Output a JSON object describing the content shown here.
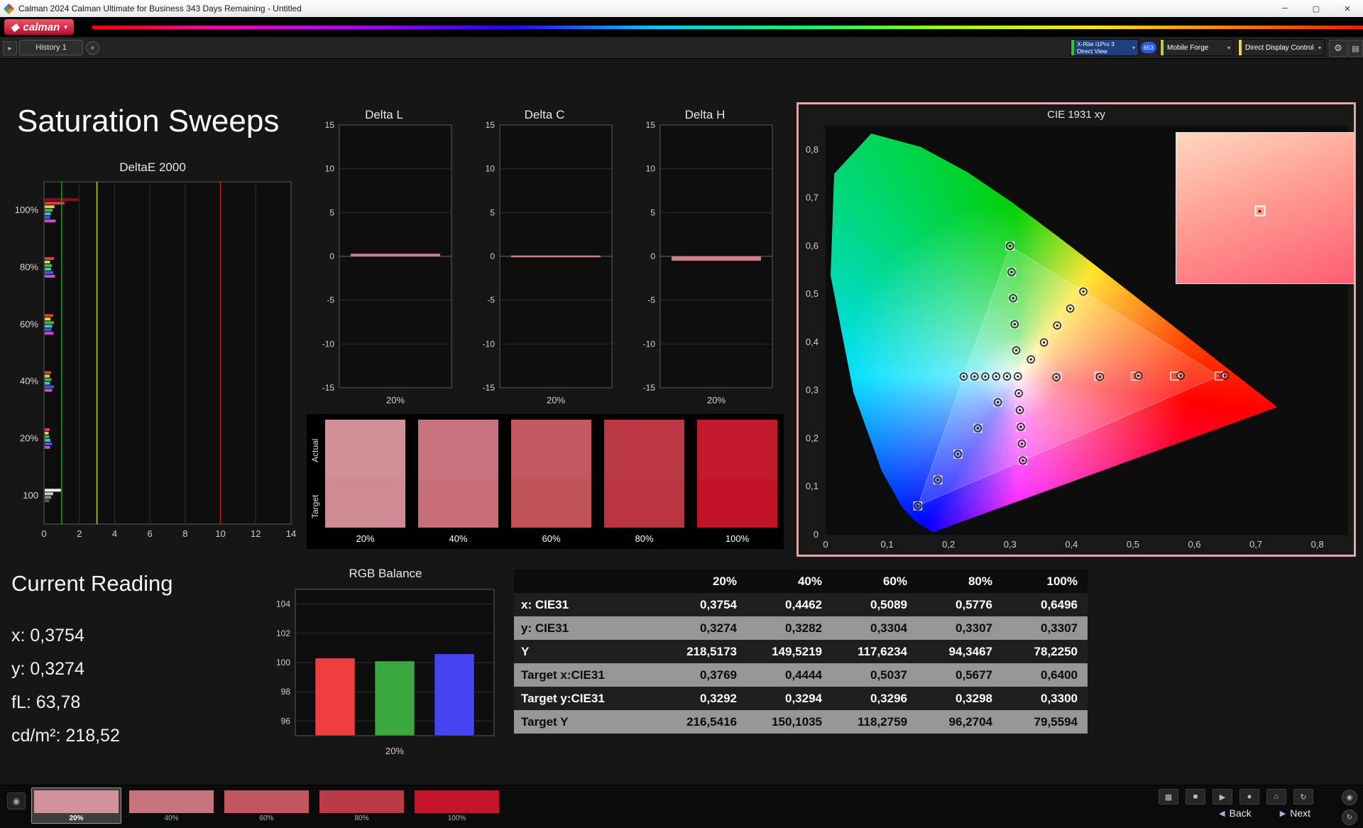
{
  "window": {
    "title": "Calman 2024 Calman Ultimate for Business 343 Days Remaining  - Untitled"
  },
  "icons": {
    "diamond": "◆",
    "dropdown": "▾",
    "toggle": "▸",
    "plus": "+",
    "gear": "⚙",
    "grid": "▤",
    "minimize": "─",
    "maximize": "▢",
    "close": "✕",
    "sensor": "◉",
    "display": "▦",
    "stop": "■",
    "play": "▶",
    "record": "●",
    "home": "⌂",
    "refresh": "↻",
    "back": "◀",
    "next": "▶",
    "round_top": "◉",
    "round_bottom": "↻"
  },
  "brand": {
    "logo_text": "calman"
  },
  "toolbar": {
    "history_tab": "History 1",
    "meter": {
      "line1": "X-Rite i1Pro 3",
      "line2": "Direct View",
      "badge": "653",
      "accent": "#35c235"
    },
    "source": {
      "label": "Mobile Forge",
      "accent": "#b7d435"
    },
    "display_control": {
      "label": "Direct Display Control",
      "accent": "#e8d44d"
    }
  },
  "page": {
    "title": "Saturation Sweeps"
  },
  "current_reading": {
    "heading": "Current Reading",
    "lines": [
      "x: 0,3754",
      "y: 0,3274",
      "fL: 63,78",
      "cd/m²: 218,52"
    ]
  },
  "swatch_strip": {
    "row_labels": [
      "Actual",
      "Target"
    ],
    "columns": [
      {
        "label": "20%",
        "actual": "#d18f98",
        "target": "#cf8b93"
      },
      {
        "label": "40%",
        "actual": "#c8737d",
        "target": "#c66e77"
      },
      {
        "label": "60%",
        "actual": "#c2575f",
        "target": "#c05259"
      },
      {
        "label": "80%",
        "actual": "#bb3944",
        "target": "#ba353f"
      },
      {
        "label": "100%",
        "actual": "#c21a2b",
        "target": "#c11426"
      }
    ]
  },
  "table": {
    "headers": [
      "",
      "20%",
      "40%",
      "60%",
      "80%",
      "100%"
    ],
    "rows": [
      {
        "label": "x: CIE31",
        "values": [
          "0,3754",
          "0,4462",
          "0,5089",
          "0,5776",
          "0,6496"
        ]
      },
      {
        "label": "y: CIE31",
        "values": [
          "0,3274",
          "0,3282",
          "0,3304",
          "0,3307",
          "0,3307"
        ]
      },
      {
        "label": "Y",
        "values": [
          "218,5173",
          "149,5219",
          "117,6234",
          "94,3467",
          "78,2250"
        ]
      },
      {
        "label": "Target x:CIE31",
        "values": [
          "0,3769",
          "0,4444",
          "0,5037",
          "0,5677",
          "0,6400"
        ]
      },
      {
        "label": "Target y:CIE31",
        "values": [
          "0,3292",
          "0,3294",
          "0,3296",
          "0,3298",
          "0,3300"
        ]
      },
      {
        "label": "Target Y",
        "values": [
          "216,5416",
          "150,1035",
          "118,2759",
          "96,2704",
          "79,5594"
        ]
      }
    ]
  },
  "bottom_bar": {
    "swatches": [
      {
        "label": "20%",
        "color": "#d2929b",
        "selected": true
      },
      {
        "label": "40%",
        "color": "#c6747d",
        "selected": false
      },
      {
        "label": "60%",
        "color": "#c0575f",
        "selected": false
      },
      {
        "label": "80%",
        "color": "#ba3a45",
        "selected": false
      },
      {
        "label": "100%",
        "color": "#c3152a",
        "selected": false
      }
    ],
    "back_label": "Back",
    "next_label": "Next"
  },
  "chart_data": [
    {
      "id": "deltaE2000",
      "type": "bar",
      "orientation": "horizontal",
      "title": "DeltaE 2000",
      "xlim": [
        0,
        14
      ],
      "xticks": [
        0,
        2,
        4,
        6,
        8,
        10,
        12,
        14
      ],
      "ref_lines": [
        {
          "value": 1,
          "color": "#19a319"
        },
        {
          "value": 3,
          "color": "#c9c919"
        },
        {
          "value": 10,
          "color": "#c91919"
        }
      ],
      "groups": [
        {
          "label": "100%",
          "bars": [
            {
              "color": "#7c1318",
              "value": 1.92
            },
            {
              "color": "#e23b3b",
              "value": 1.12
            },
            {
              "color": "#d6d64a",
              "value": 0.55
            },
            {
              "color": "#46b34a",
              "value": 0.45
            },
            {
              "color": "#3fc6c6",
              "value": 0.34
            },
            {
              "color": "#4656e2",
              "value": 0.3
            },
            {
              "color": "#cc4ccc",
              "value": 0.62
            }
          ]
        },
        {
          "label": "80%",
          "bars": [
            {
              "color": "#e23b3b",
              "value": 0.52
            },
            {
              "color": "#d6d64a",
              "value": 0.3
            },
            {
              "color": "#46b34a",
              "value": 0.4
            },
            {
              "color": "#3fc6c6",
              "value": 0.36
            },
            {
              "color": "#4656e2",
              "value": 0.48
            },
            {
              "color": "#cc4ccc",
              "value": 0.58
            }
          ]
        },
        {
          "label": "60%",
          "bars": [
            {
              "color": "#e23b3b",
              "value": 0.47
            },
            {
              "color": "#d6d64a",
              "value": 0.33
            },
            {
              "color": "#46b34a",
              "value": 0.52
            },
            {
              "color": "#3fc6c6",
              "value": 0.42
            },
            {
              "color": "#4656e2",
              "value": 0.38
            },
            {
              "color": "#cc4ccc",
              "value": 0.5
            }
          ]
        },
        {
          "label": "40%",
          "bars": [
            {
              "color": "#e23b3b",
              "value": 0.36
            },
            {
              "color": "#d6d64a",
              "value": 0.28
            },
            {
              "color": "#46b34a",
              "value": 0.38
            },
            {
              "color": "#3fc6c6",
              "value": 0.3
            },
            {
              "color": "#4656e2",
              "value": 0.52
            },
            {
              "color": "#cc4ccc",
              "value": 0.42
            }
          ]
        },
        {
          "label": "20%",
          "bars": [
            {
              "color": "#e23b3b",
              "value": 0.28
            },
            {
              "color": "#d6d64a",
              "value": 0.22
            },
            {
              "color": "#46b34a",
              "value": 0.26
            },
            {
              "color": "#3fc6c6",
              "value": 0.32
            },
            {
              "color": "#4656e2",
              "value": 0.42
            },
            {
              "color": "#cc4ccc",
              "value": 0.3
            }
          ]
        },
        {
          "label": "100",
          "bars": [
            {
              "color": "#f0f0f0",
              "value": 0.92
            },
            {
              "color": "#c8c8c8",
              "value": 0.48
            },
            {
              "color": "#8e8e8e",
              "value": 0.36
            },
            {
              "color": "#5a5a5a",
              "value": 0.26
            }
          ]
        }
      ]
    },
    {
      "id": "deltaL",
      "type": "bar",
      "title": "Delta L",
      "categories": [
        "20%"
      ],
      "values": [
        0.3
      ],
      "bar_color": "#cf8089",
      "ylim": [
        -15,
        15
      ],
      "yticks": [
        15,
        10,
        5,
        0,
        -5,
        -10,
        -15
      ]
    },
    {
      "id": "deltaC",
      "type": "bar",
      "title": "Delta C",
      "categories": [
        "20%"
      ],
      "values": [
        0.1
      ],
      "bar_color": "#cf8089",
      "ylim": [
        -15,
        15
      ],
      "yticks": [
        15,
        10,
        5,
        0,
        -5,
        -10,
        -15
      ]
    },
    {
      "id": "deltaH",
      "type": "bar",
      "title": "Delta H",
      "categories": [
        "20%"
      ],
      "values": [
        -0.5
      ],
      "bar_color": "#cf8089",
      "ylim": [
        -15,
        15
      ],
      "yticks": [
        15,
        10,
        5,
        0,
        -5,
        -10,
        -15
      ]
    },
    {
      "id": "cie1931",
      "type": "scatter",
      "title": "CIE 1931 xy",
      "xlim": [
        0,
        0.85
      ],
      "ylim": [
        0,
        0.85
      ],
      "ticks": {
        "values": [
          0,
          0.1,
          0.2,
          0.3,
          0.4,
          0.5,
          0.6,
          0.7,
          0.8
        ],
        "labels": [
          "0",
          "0,1",
          "0,2",
          "0,3",
          "0,4",
          "0,5",
          "0,6",
          "0,7",
          "0,8"
        ]
      },
      "white_point": [
        0.3127,
        0.329
      ],
      "gamut_triangle": [
        [
          0.64,
          0.33
        ],
        [
          0.3,
          0.6
        ],
        [
          0.15,
          0.06
        ]
      ],
      "sweeps": {
        "red": {
          "measured": [
            [
              0.3754,
              0.3274
            ],
            [
              0.4462,
              0.3282
            ],
            [
              0.5089,
              0.3304
            ],
            [
              0.5776,
              0.3307
            ],
            [
              0.6496,
              0.3307
            ]
          ],
          "targets": [
            [
              0.3769,
              0.3292
            ],
            [
              0.4444,
              0.3294
            ],
            [
              0.5037,
              0.3296
            ],
            [
              0.5677,
              0.3298
            ],
            [
              0.64,
              0.33
            ]
          ]
        },
        "green": {
          "measured": [
            [
              0.3102,
              0.3832
            ],
            [
              0.3076,
              0.4374
            ],
            [
              0.3051,
              0.4916
            ],
            [
              0.3025,
              0.5458
            ],
            [
              0.3,
              0.6
            ]
          ]
        },
        "blue": {
          "measured": [
            [
              0.2802,
              0.2752
            ],
            [
              0.2476,
              0.2214
            ],
            [
              0.2151,
              0.1676
            ],
            [
              0.1825,
              0.1138
            ],
            [
              0.15,
              0.06
            ]
          ]
        },
        "cyan": {
          "measured": [
            [
              0.2951,
              0.3289
            ],
            [
              0.2775,
              0.3289
            ],
            [
              0.2598,
              0.3288
            ],
            [
              0.2422,
              0.3288
            ],
            [
              0.2246,
              0.3287
            ]
          ]
        },
        "magenta": {
          "measured": [
            [
              0.3143,
              0.294
            ],
            [
              0.316,
              0.2591
            ],
            [
              0.3176,
              0.2241
            ],
            [
              0.3193,
              0.1892
            ],
            [
              0.3209,
              0.1542
            ]
          ]
        },
        "yellow": {
          "measured": [
            [
              0.334,
              0.3643
            ],
            [
              0.3553,
              0.3995
            ],
            [
              0.3767,
              0.4348
            ],
            [
              0.398,
              0.47
            ],
            [
              0.4193,
              0.5053
            ]
          ]
        }
      },
      "inset": {
        "marker": [
          0.47,
          0.52
        ]
      }
    },
    {
      "id": "rgbBalance",
      "type": "bar",
      "title": "RGB Balance",
      "categories": [
        "Red",
        "Green",
        "Blue"
      ],
      "values": [
        100.3,
        100.1,
        100.6
      ],
      "colors": [
        "#f03e3e",
        "#3aa83e",
        "#4444f0"
      ],
      "ylim": [
        95,
        105
      ],
      "yticks": [
        96,
        98,
        100,
        102,
        104
      ],
      "xlabel": "20%"
    }
  ]
}
